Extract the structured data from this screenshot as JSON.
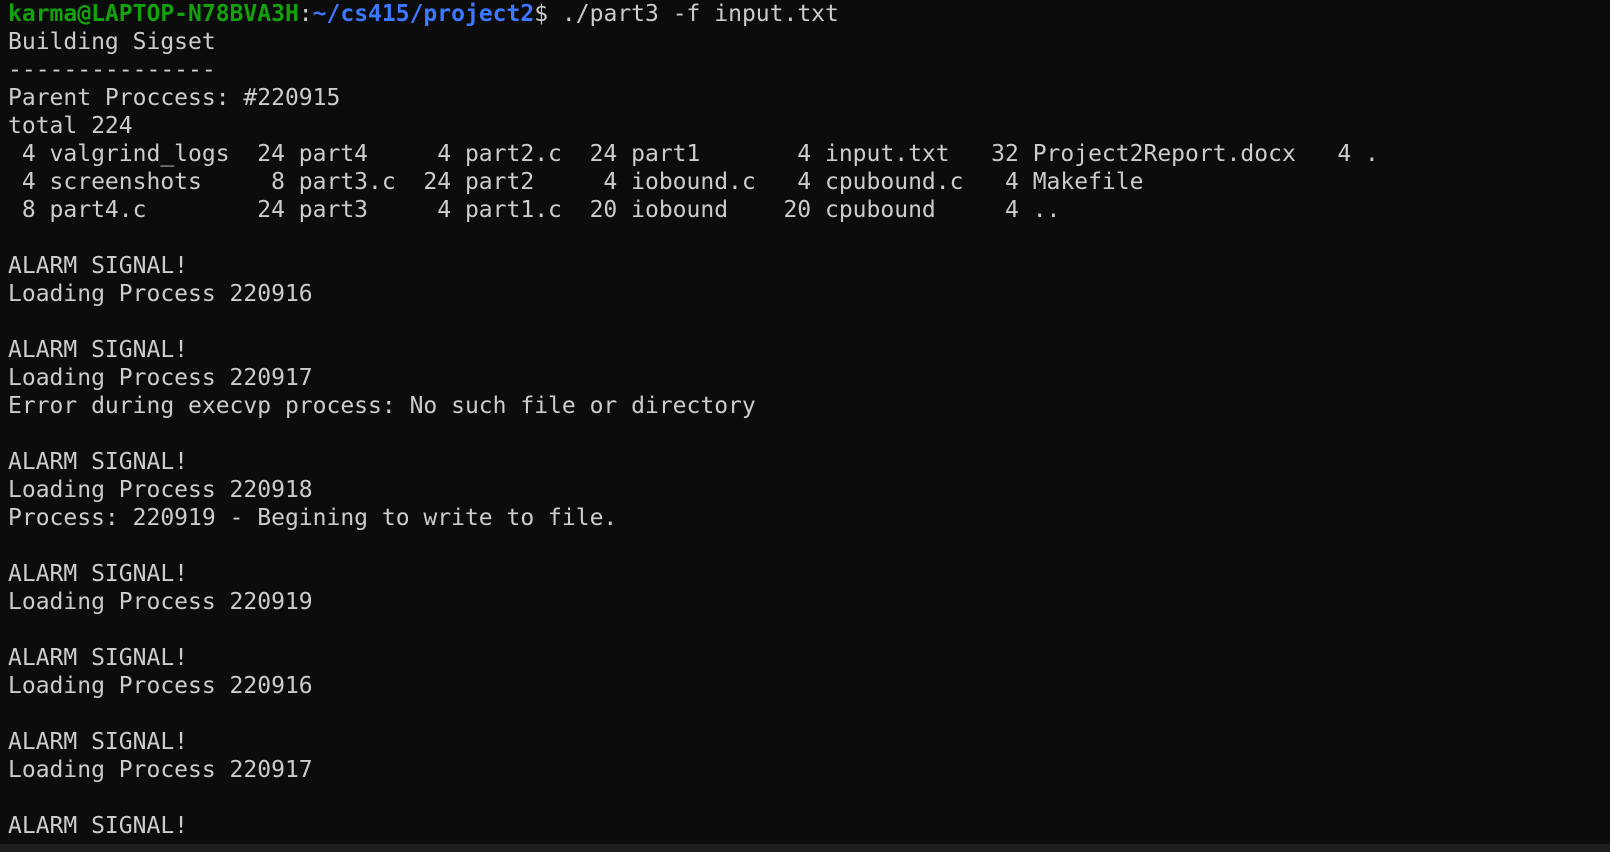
{
  "prompt": {
    "user_host": "karma@LAPTOP-N78BVA3H",
    "separator": ":",
    "path": "~/cs415/project2",
    "dollar": "$",
    "command": " ./part3 -f input.txt"
  },
  "output_lines": [
    "Building Sigset",
    "---------------",
    "Parent Proccess: #220915",
    "total 224",
    " 4 valgrind_logs  24 part4     4 part2.c  24 part1       4 input.txt   32 Project2Report.docx   4 .",
    " 4 screenshots     8 part3.c  24 part2     4 iobound.c   4 cpubound.c   4 Makefile",
    " 8 part4.c        24 part3     4 part1.c  20 iobound    20 cpubound     4 ..",
    "",
    "ALARM SIGNAL!",
    "Loading Process 220916",
    "",
    "ALARM SIGNAL!",
    "Loading Process 220917",
    "Error during execvp process: No such file or directory",
    "",
    "ALARM SIGNAL!",
    "Loading Process 220918",
    "Process: 220919 - Begining to write to file.",
    "",
    "ALARM SIGNAL!",
    "Loading Process 220919",
    "",
    "ALARM SIGNAL!",
    "Loading Process 220916",
    "",
    "ALARM SIGNAL!",
    "Loading Process 220917",
    "",
    "ALARM SIGNAL!"
  ]
}
